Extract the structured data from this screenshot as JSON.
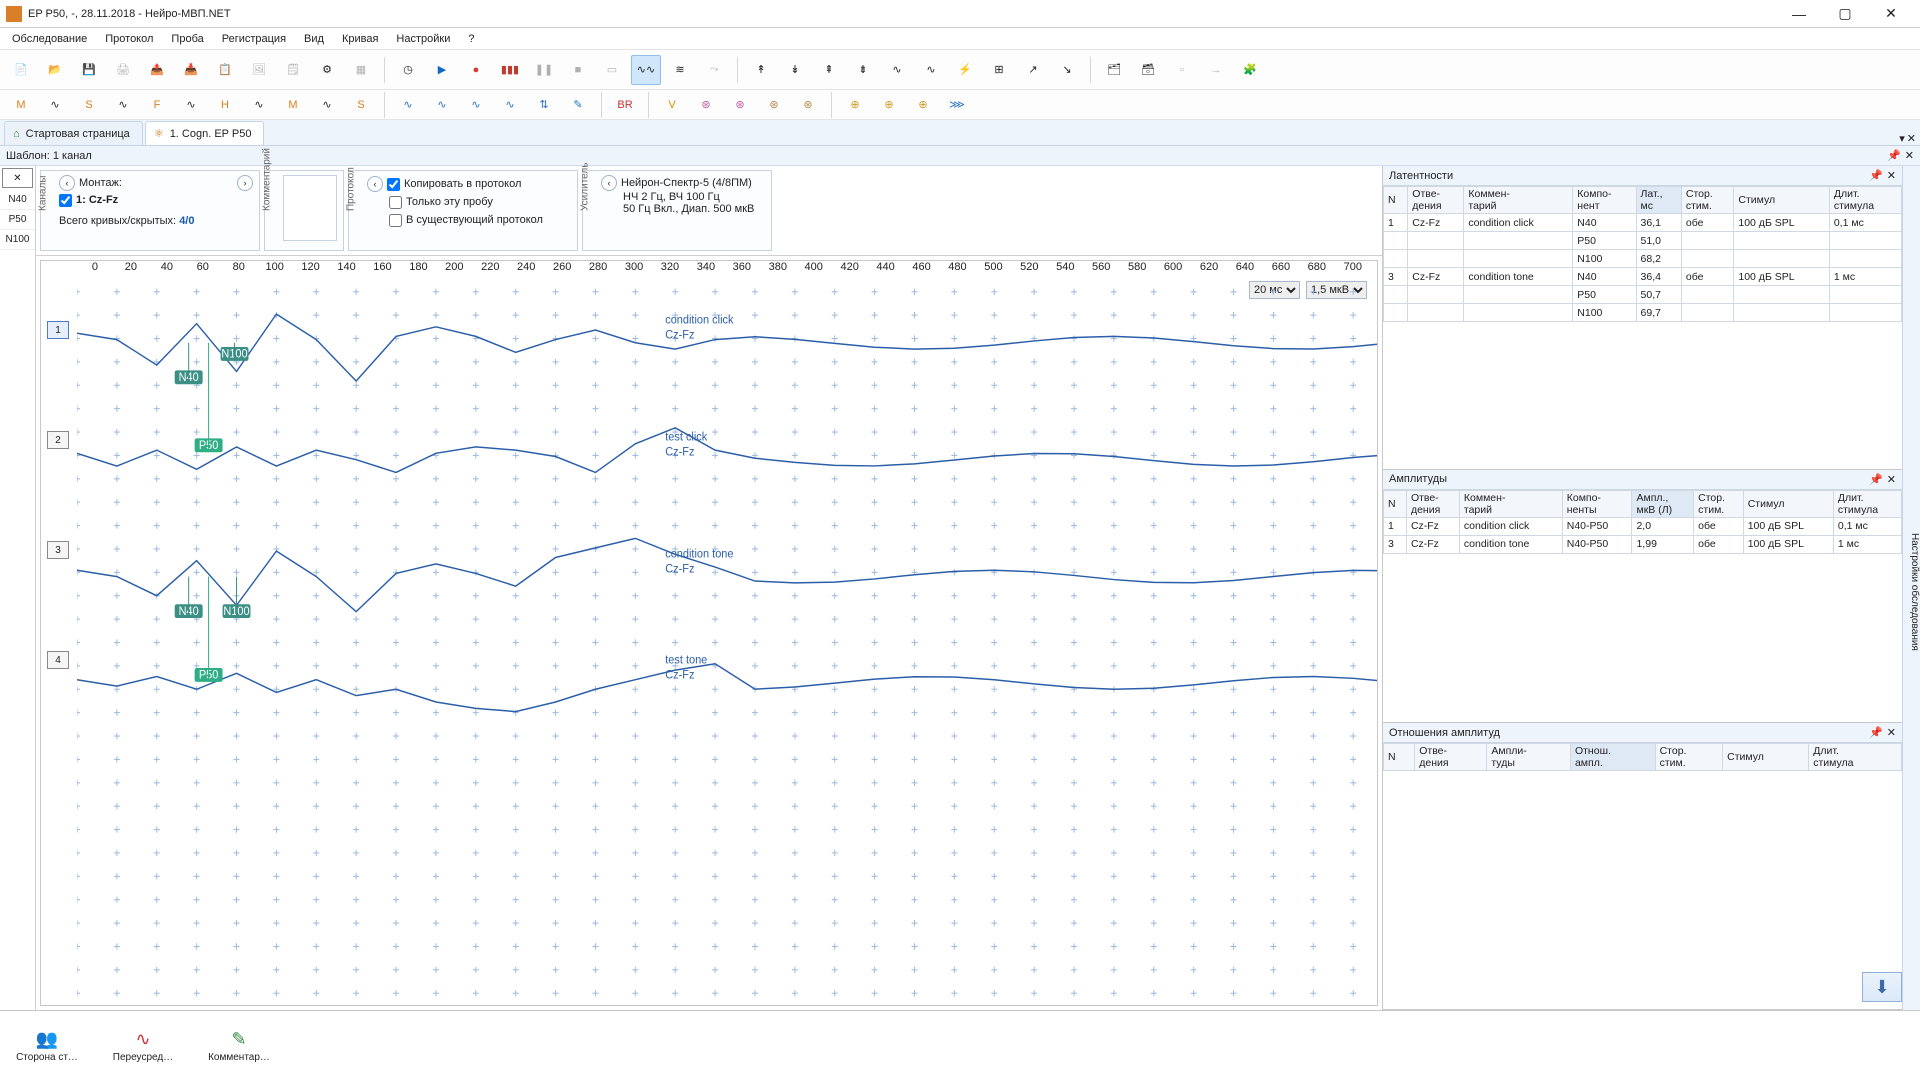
{
  "title": "EP P50, -, 28.11.2018 - Нейро-МВП.NET",
  "menu": [
    "Обследование",
    "Протокол",
    "Проба",
    "Регистрация",
    "Вид",
    "Кривая",
    "Настройки",
    "?"
  ],
  "tabs": {
    "t1": "Стартовая страница",
    "t2": "1. Cogn. EP P50"
  },
  "subheader": "Шаблон: 1 канал",
  "leftcol": [
    "N40",
    "P50",
    "N100"
  ],
  "cfg": {
    "montage_caption": "Каналы",
    "montage_label": "Монтаж:",
    "ch1": "1: Cz-Fz",
    "curves_label": "Всего кривых/скрытых:",
    "curves_val": "4/0",
    "comment_caption": "Комментарий",
    "copy_caption": "Протокол",
    "copy_proto": "Копировать в протокол",
    "only_probe": "Только эту пробу",
    "in_exist": "В существующий протокол",
    "amp_caption": "Усилитель",
    "amp_name": "Нейрон-Спектр-5 (4/8ПМ)",
    "amp_line2": "НЧ  2 Гц, ВЧ  100 Гц",
    "amp_line3": "50 Гц  Вкл., Диап.  500 мкВ"
  },
  "ruler_start": 0,
  "ruler_step": 20,
  "ruler_count": 36,
  "time_opts": [
    "20 мс"
  ],
  "amp_opts": [
    "1,5 мкВ"
  ],
  "time_sel": "20 мс",
  "amp_sel": "1,5 мкВ",
  "tracks": [
    {
      "n": "1",
      "labelTop": "condition click",
      "labelBot": "Cz-Fz"
    },
    {
      "n": "2",
      "labelTop": "test click",
      "labelBot": "Cz-Fz"
    },
    {
      "n": "3",
      "labelTop": "condition tone",
      "labelBot": "Cz-Fz"
    },
    {
      "n": "4",
      "labelTop": "test tone",
      "labelBot": "Cz-Fz"
    }
  ],
  "markers": {
    "t1": [
      {
        "name": "N40",
        "x": 112,
        "y": 40
      },
      {
        "name": "N100",
        "x": 158,
        "y": 18
      },
      {
        "name": "P50",
        "x": 132,
        "y": 104
      }
    ],
    "t3": [
      {
        "name": "N40",
        "x": 112,
        "y": 40
      },
      {
        "name": "N100",
        "x": 160,
        "y": 40
      },
      {
        "name": "P50",
        "x": 132,
        "y": 100
      }
    ]
  },
  "right_tab": "Настройки обследования",
  "lat": {
    "title": "Латентности",
    "cols": [
      "N",
      "Отве-\nдения",
      "Коммен-\nтарий",
      "Компо-\nнент",
      "Лат.,\nмс",
      "Стор.\nстим.",
      "Стимул",
      "Длит.\nстимула"
    ],
    "rows": [
      [
        "1",
        "Cz-Fz",
        "condition click",
        "N40",
        "36,1",
        "обе",
        "100 дБ SPL",
        "0,1 мс"
      ],
      [
        "",
        "",
        "",
        "P50",
        "51,0",
        "",
        "",
        ""
      ],
      [
        "",
        "",
        "",
        "N100",
        "68,2",
        "",
        "",
        ""
      ],
      [
        "3",
        "Cz-Fz",
        "condition tone",
        "N40",
        "36,4",
        "обе",
        "100 дБ SPL",
        "1 мс"
      ],
      [
        "",
        "",
        "",
        "P50",
        "50,7",
        "",
        "",
        ""
      ],
      [
        "",
        "",
        "",
        "N100",
        "69,7",
        "",
        "",
        ""
      ]
    ]
  },
  "amp": {
    "title": "Амплитуды",
    "cols": [
      "N",
      "Отве-\nдения",
      "Коммен-\nтарий",
      "Компо-\nненты",
      "Ампл.,\nмкВ (Л)",
      "Стор.\nстим.",
      "Стимул",
      "Длит.\nстимула"
    ],
    "rows": [
      [
        "1",
        "Cz-Fz",
        "condition click",
        "N40-P50",
        "2,0",
        "обе",
        "100 дБ SPL",
        "0,1 мс"
      ],
      [
        "3",
        "Cz-Fz",
        "condition tone",
        "N40-P50",
        "1,99",
        "обе",
        "100 дБ SPL",
        "1 мс"
      ]
    ]
  },
  "ratio": {
    "title": "Отношения амплитуд",
    "cols": [
      "N",
      "Отве-\nдения",
      "Ампли-\nтуды",
      "Отнош.\nампл.",
      "Стор.\nстим.",
      "Стимул",
      "Длит.\nстимула"
    ],
    "rows": []
  },
  "bottom": [
    "Сторона ст…",
    "Переусред…",
    "Комментар…"
  ],
  "chart_data": {
    "type": "line",
    "x_ms": [
      0,
      20,
      40,
      60,
      80,
      100,
      120,
      140,
      160,
      180,
      200,
      220,
      240,
      260,
      280,
      300,
      320
    ],
    "series": [
      {
        "name": "1 condition click Cz-Fz",
        "uv": [
          0.3,
          0.1,
          -0.7,
          0.6,
          -0.9,
          0.9,
          0.1,
          -1.2,
          0.2,
          0.5,
          0.2,
          -0.3,
          0.1,
          0.4,
          0.0,
          -0.2,
          0.1
        ]
      },
      {
        "name": "2 test click Cz-Fz",
        "uv": [
          0.2,
          -0.2,
          0.3,
          -0.3,
          0.4,
          -0.2,
          0.3,
          0.0,
          -0.4,
          0.2,
          0.4,
          0.3,
          0.1,
          -0.4,
          0.5,
          1.0,
          0.3
        ]
      },
      {
        "name": "3 condition tone Cz-Fz",
        "uv": [
          0.2,
          0.0,
          -0.6,
          0.5,
          -0.9,
          0.8,
          0.0,
          -1.1,
          0.1,
          0.4,
          0.1,
          -0.3,
          0.6,
          0.9,
          1.2,
          0.7,
          0.3
        ]
      },
      {
        "name": "4 test tone Cz-Fz",
        "uv": [
          0.1,
          -0.1,
          0.2,
          -0.2,
          0.3,
          -0.3,
          0.1,
          -0.4,
          -0.2,
          -0.6,
          -0.8,
          -0.9,
          -0.6,
          -0.2,
          0.1,
          0.4,
          0.6
        ]
      }
    ],
    "x_unit": "мс",
    "y_unit": "мкВ",
    "x_scale": "20 мс",
    "y_scale": "1,5 мкВ"
  }
}
